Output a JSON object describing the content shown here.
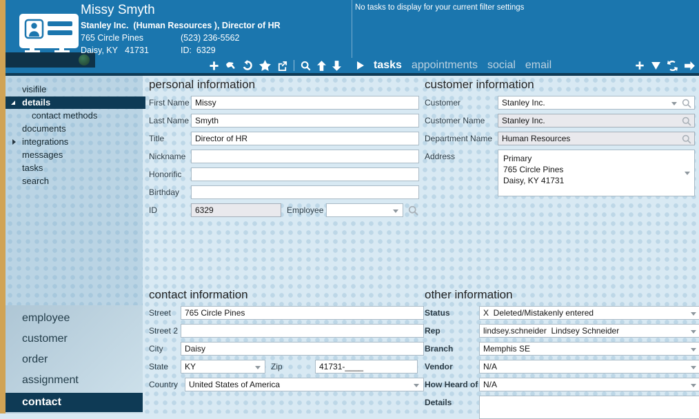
{
  "colors": {
    "header_blue": "#1b76ae",
    "navy": "#0e3a55",
    "gold_accent": "#d0a355",
    "sidebar_bg": "#bad4e4",
    "main_bg": "#d8e9f3",
    "status_dot_green": "#2e5f45",
    "active_tab_text": "#ffffff",
    "inactive_tab_text": "#bdd2e0"
  },
  "header": {
    "name": "Missy Smyth",
    "company_line": "Stanley Inc.  (Human Resources ), Director of HR",
    "street": "765 Circle Pines",
    "phone": "(523) 236-5562",
    "city_line": "Daisy, KY   41731",
    "id_line": "ID:  6329",
    "tasks_message": "No tasks to display for your current filter settings",
    "tabs": [
      {
        "label": "tasks",
        "active": true
      },
      {
        "label": "appointments",
        "active": false
      },
      {
        "label": "social",
        "active": false
      },
      {
        "label": "email",
        "active": false
      }
    ],
    "toolbar_left_icons": [
      "add",
      "hand-select",
      "refresh-record",
      "favorite",
      "open-external",
      "search",
      "move-up",
      "move-down"
    ],
    "toolbar_right_icons": [
      "add",
      "filter",
      "refresh",
      "forward"
    ]
  },
  "sidebar": {
    "items": [
      {
        "label": "visifile"
      },
      {
        "label": "details",
        "selected": true,
        "expanded": true
      },
      {
        "label": "contact methods",
        "child": true
      },
      {
        "label": "documents"
      },
      {
        "label": "integrations",
        "expandable": true
      },
      {
        "label": "messages"
      },
      {
        "label": "tasks"
      },
      {
        "label": "search"
      }
    ]
  },
  "bottom_nav": {
    "items": [
      {
        "label": "employee"
      },
      {
        "label": "customer"
      },
      {
        "label": "order"
      },
      {
        "label": "assignment"
      },
      {
        "label": "contact",
        "selected": true
      }
    ]
  },
  "sections": {
    "personal": {
      "title": "personal information",
      "rows": [
        {
          "label": "First Name",
          "value": "Missy"
        },
        {
          "label": "Last Name",
          "value": "Smyth"
        },
        {
          "label": "Title",
          "value": "Director of HR"
        },
        {
          "label": "Nickname",
          "value": ""
        },
        {
          "label": "Honorific",
          "value": ""
        },
        {
          "label": "Birthday",
          "value": ""
        }
      ],
      "id_label": "ID",
      "id_value": "6329",
      "employee_label": "Employee",
      "employee_value": ""
    },
    "customer": {
      "title": "customer information",
      "customer_label": "Customer",
      "customer_value": "Stanley Inc.",
      "customer_name_label": "Customer Name",
      "customer_name_value": "Stanley Inc.",
      "department_label": "Department Name",
      "department_value": "Human Resources",
      "address_label": "Address",
      "address_lines": [
        "Primary",
        "765 Circle Pines",
        "Daisy, KY 41731"
      ]
    },
    "contact": {
      "title": "contact information",
      "street_label": "Street",
      "street_value": "765 Circle Pines",
      "street2_label": "Street 2",
      "street2_value": "",
      "city_label": "City",
      "city_value": "Daisy",
      "state_label": "State",
      "state_value": "KY",
      "zip_label": "Zip",
      "zip_value": "41731-____",
      "country_label": "Country",
      "country_value": "United States of America"
    },
    "other": {
      "title": "other information",
      "rows": [
        {
          "label": "Status",
          "value": "X  Deleted/Mistakenly entered"
        },
        {
          "label": "Rep",
          "value": "lindsey.schneider  Lindsey Schneider"
        },
        {
          "label": "Branch",
          "value": "Memphis SE"
        },
        {
          "label": "Vendor",
          "value": "N/A"
        },
        {
          "label": "How Heard of",
          "value": "N/A"
        }
      ],
      "details_label": "Details",
      "details_value": ""
    }
  }
}
